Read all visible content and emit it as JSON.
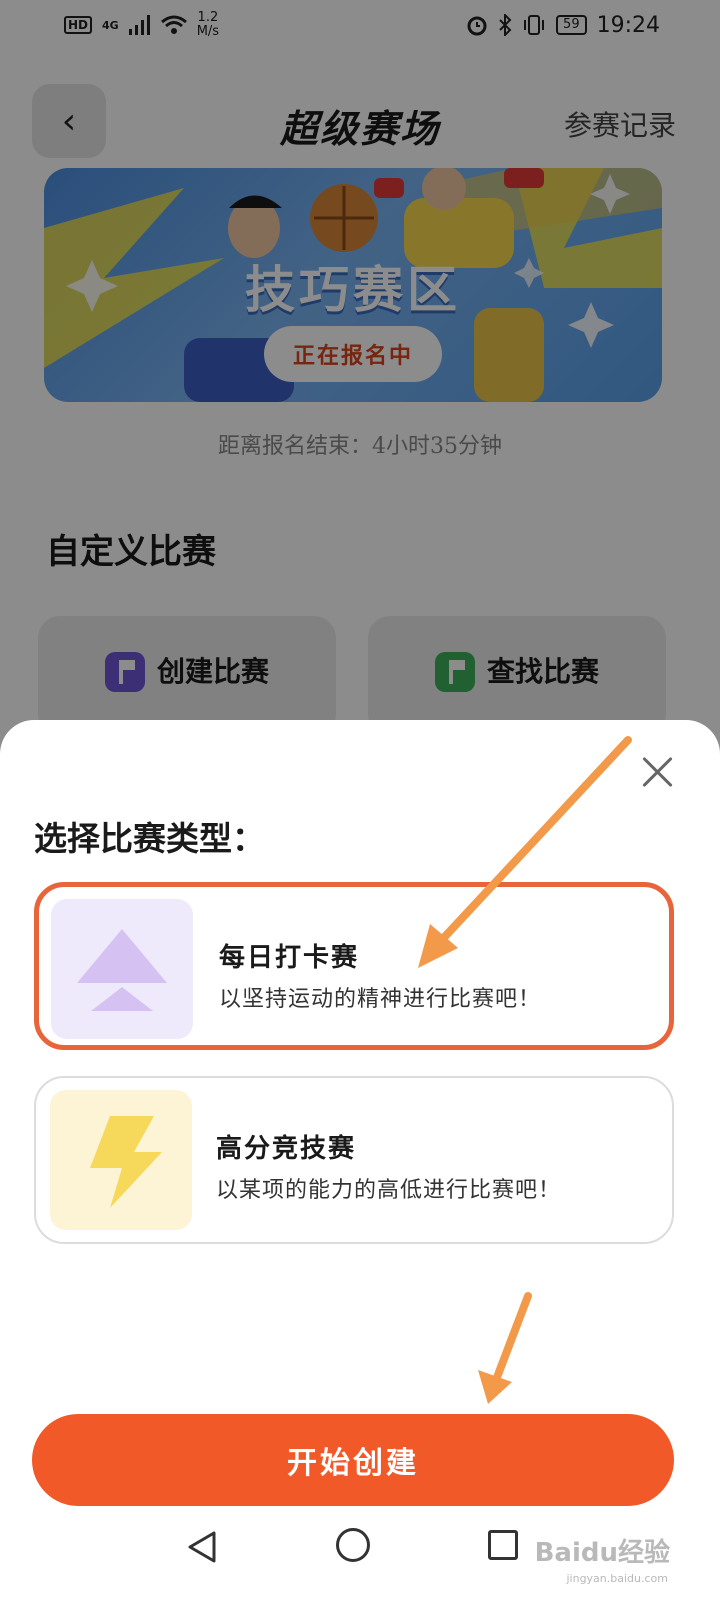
{
  "status_bar": {
    "hd": "HD",
    "network": "4G",
    "speed_value": "1.2",
    "speed_unit": "M/s",
    "battery": "59",
    "time": "19:24"
  },
  "header": {
    "title": "超级赛场",
    "records_link": "参赛记录"
  },
  "banner": {
    "title": "技巧赛区",
    "cta": "正在报名中"
  },
  "countdown": "距离报名结束：4小时35分钟",
  "custom_section": {
    "title": "自定义比赛",
    "create_label": "创建比赛",
    "find_label": "查找比赛"
  },
  "sheet": {
    "title": "选择比赛类型：",
    "options": [
      {
        "name": "每日打卡赛",
        "desc": "以坚持运动的精神进行比赛吧！",
        "selected": true
      },
      {
        "name": "高分竞技赛",
        "desc": "以某项的能力的高低进行比赛吧！",
        "selected": false
      }
    ],
    "start_button": "开始创建"
  },
  "colors": {
    "accent": "#f15a28",
    "selected_border": "#e8643a",
    "annotation_arrow": "#f39a4a"
  },
  "watermark": {
    "text": "Baidu经验",
    "sub": "jingyan.baidu.com"
  }
}
